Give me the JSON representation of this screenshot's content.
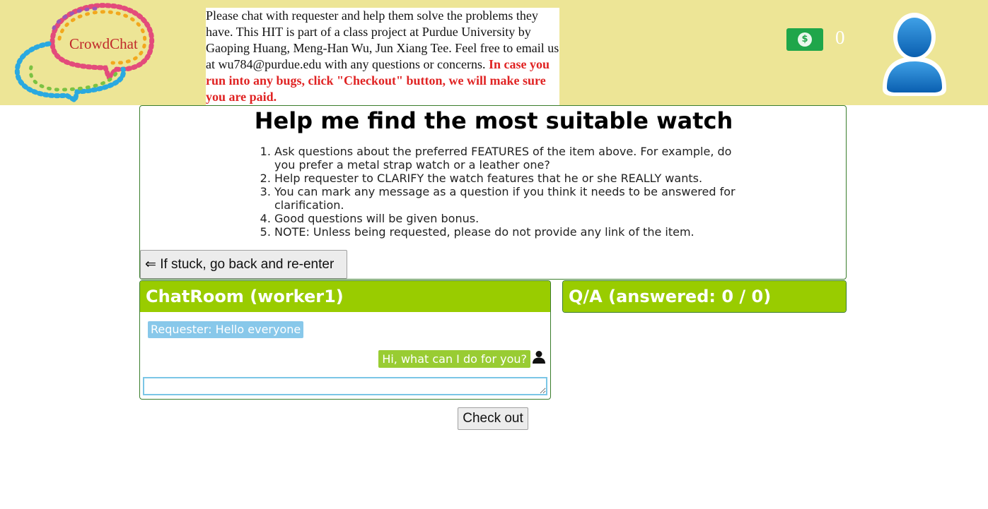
{
  "header": {
    "logo_text": "CrowdChat",
    "intro_text": "Please chat with requester and help them solve the problems they have. This HIT is part of a class project at Purdue University by Gaoping Huang, Meng-Han Wu, Jun Xiang Tee. Feel free to email us at wu784@purdue.edu with any questions or concerns. ",
    "intro_warning": "In case you run into any bugs, click \"Checkout\" button, we will make sure you are paid.",
    "money_symbol": "$",
    "balance": "0",
    "colors": {
      "background": "#ede596",
      "money_badge": "#1fa64a",
      "warning": "#e02323"
    }
  },
  "task": {
    "title": "Help me find the most suitable watch",
    "instructions": [
      "Ask questions about the preferred FEATURES of the item above. For example, do you prefer a metal strap watch or a leather one?",
      "Help requester to CLARIFY the watch features that he or she REALLY wants.",
      "You can mark any message as a question if you think it needs to be answered for clarification.",
      "Good questions will be given bonus.",
      "NOTE: Unless being requested, please do not provide any link of the item."
    ],
    "back_button_label": "⇐ If stuck, go back and re-enter"
  },
  "chat": {
    "title": "ChatRoom (worker1)",
    "messages": [
      {
        "text": "Requester: Hello everyone",
        "side": "left"
      },
      {
        "text": "Hi, what can I do for you?",
        "side": "right"
      }
    ],
    "input_value": "",
    "colors": {
      "header": "#99cc00",
      "incoming": "#88c8ea",
      "outgoing": "#99cc33"
    }
  },
  "qa": {
    "title": "Q/A (answered: 0 / 0)"
  },
  "checkout_label": "Check out"
}
